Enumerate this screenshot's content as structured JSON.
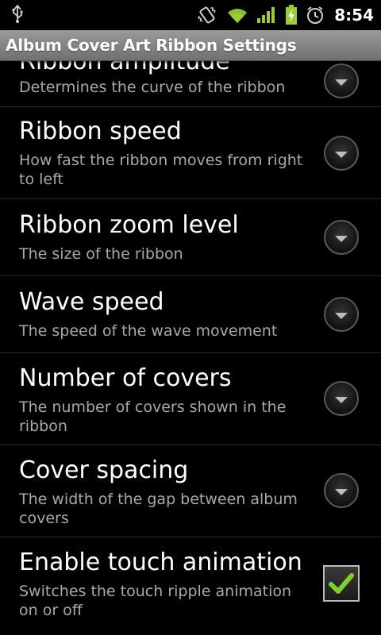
{
  "status_bar": {
    "time": "8:54",
    "icons": [
      "usb-icon",
      "vibrate-icon",
      "wifi-icon",
      "signal-icon",
      "battery-charging-icon",
      "alarm-icon"
    ],
    "accent_color": "#9ACD32"
  },
  "title_bar": {
    "title": "Album Cover Art Ribbon Settings"
  },
  "preferences": [
    {
      "title": "Ribbon amplitude",
      "summary": "Determines the curve of the ribbon",
      "widget": "dropdown"
    },
    {
      "title": "Ribbon speed",
      "summary": "How fast the ribbon moves from right to left",
      "widget": "dropdown"
    },
    {
      "title": "Ribbon zoom level",
      "summary": "The size of the ribbon",
      "widget": "dropdown"
    },
    {
      "title": "Wave speed",
      "summary": "The speed of the wave movement",
      "widget": "dropdown"
    },
    {
      "title": "Number of covers",
      "summary": "The number of covers shown in the ribbon",
      "widget": "dropdown"
    },
    {
      "title": "Cover spacing",
      "summary": "The width of the gap between album covers",
      "widget": "dropdown"
    },
    {
      "title": "Enable touch animation",
      "summary": "Switches the touch ripple animation on or off",
      "widget": "checkbox",
      "checked": true
    }
  ]
}
